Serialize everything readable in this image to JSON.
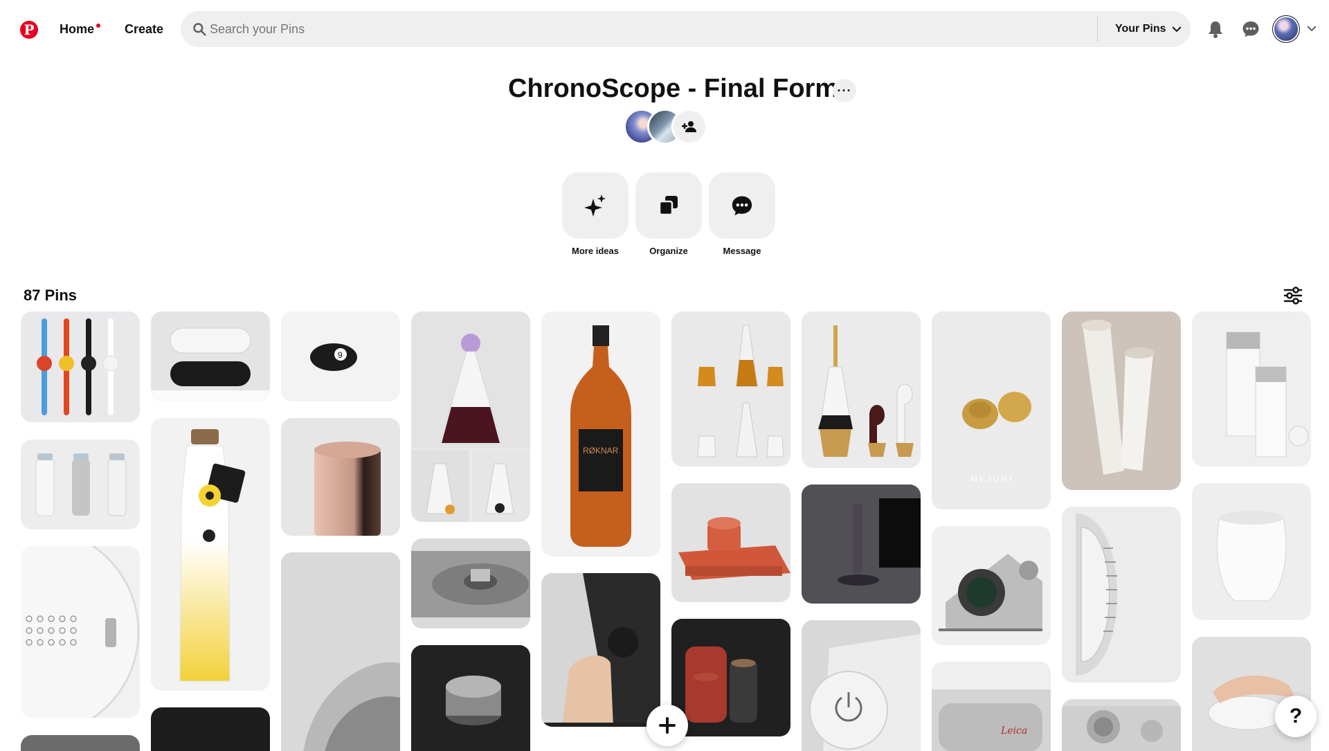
{
  "header": {
    "logo_label": "P",
    "home_label": "Home",
    "create_label": "Create",
    "search_placeholder": "Search your Pins",
    "your_pins_label": "Your Pins",
    "brand_color": "#e60023"
  },
  "board": {
    "title": "ChronoScope - Final Form",
    "more_label": "···",
    "tools": [
      {
        "label": "More ideas",
        "icon": "sparkle-icon"
      },
      {
        "label": "Organize",
        "icon": "organize-icon"
      },
      {
        "label": "Message",
        "icon": "message-icon"
      }
    ],
    "pins_count_label": "87 Pins"
  },
  "help_label": "?"
}
